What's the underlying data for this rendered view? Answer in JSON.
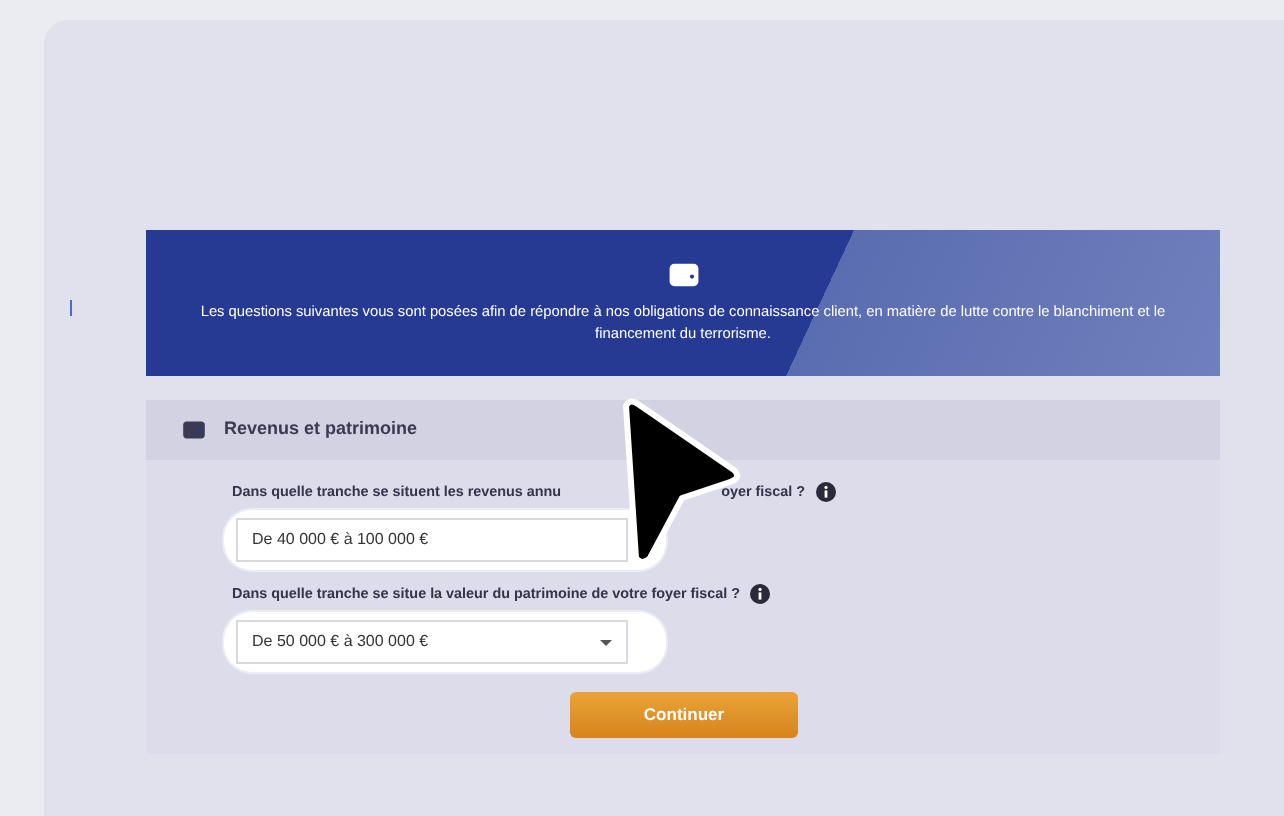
{
  "banner": {
    "text": "Les questions suivantes vous sont posées afin de répondre à nos obligations de connaissance client, en matière de lutte contre le blanchiment et le financement du terrorisme."
  },
  "section": {
    "title": "Revenus et patrimoine"
  },
  "questions": [
    {
      "label_parts": [
        "Dans quelle tranche se situent les revenus annu",
        "oyer fiscal ?"
      ],
      "value": "De 40 000 € à 100 000 €",
      "caret_visible": false
    },
    {
      "label_parts": [
        "Dans quelle tranche se situe la valeur du patrimoine de votre foyer fiscal ?"
      ],
      "value": "De 50 000 € à 300 000 €",
      "caret_visible": true
    }
  ],
  "continue_button": "Continuer"
}
